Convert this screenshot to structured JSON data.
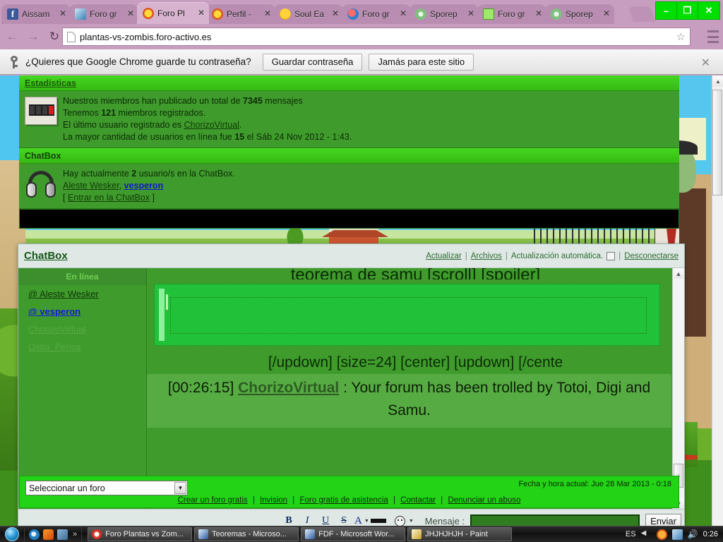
{
  "browser": {
    "tabs": [
      {
        "title": "Aissam",
        "favicon": "facebook-icon",
        "active": false
      },
      {
        "title": "Foro gr",
        "favicon": "forum-blue-icon",
        "active": false
      },
      {
        "title": "Foro Pl",
        "favicon": "sunflower-icon",
        "active": true
      },
      {
        "title": "Perfil -",
        "favicon": "sunflower-icon",
        "active": false
      },
      {
        "title": "Soul Ea",
        "favicon": "soul-icon",
        "active": false
      },
      {
        "title": "Foro gr",
        "favicon": "forum-red-icon",
        "active": false
      },
      {
        "title": "Sporep",
        "favicon": "spore-icon",
        "active": false
      },
      {
        "title": "Foro gr",
        "favicon": "chat-green-icon",
        "active": false
      },
      {
        "title": "Sporep",
        "favicon": "spore-icon",
        "active": false
      }
    ],
    "url": "plantas-vs-zombis.foro-activo.es",
    "window_controls": {
      "minimize": "–",
      "restore": "❐",
      "close": "✕"
    },
    "accent_color": "#c89ec0"
  },
  "infobar": {
    "icon": "key-icon",
    "question": "¿Quieres que Google Chrome guarde tu contraseña?",
    "save_label": "Guardar contraseña",
    "never_label": "Jamás para este sitio",
    "close_label": "✕"
  },
  "statistics": {
    "title": "Estadísticas",
    "icon": "counter-icon",
    "line1_pre": "Nuestros miembros han publicado un total de ",
    "line1_count": "7345",
    "line1_post": " mensajes",
    "line2_pre": "Tenemos ",
    "line2_count": "121",
    "line2_post": " miembros registrados.",
    "line3_pre": "El último usuario registrado es ",
    "line3_user": "ChorizoVirtual",
    "line3_post": ".",
    "line4_pre": "La mayor cantidad de usuarios en línea fue ",
    "line4_count": "15",
    "line4_post": " el Sáb 24 Nov 2012 - 1:43."
  },
  "chatbox_block": {
    "title": "ChatBox",
    "icon": "headphones-icon",
    "line1_pre": "Hay actualmente ",
    "line1_count": "2",
    "line1_post": " usuario/s en la ChatBox.",
    "user1": "Aleste Wesker",
    "user_sep": ", ",
    "user2": "vesperon",
    "enter_bracket_open": "[ ",
    "enter_link": "Entrar en la ChatBox",
    "enter_bracket_close": " ]"
  },
  "chatbox_window": {
    "title": "ChatBox",
    "header_links": {
      "refresh": "Actualizar",
      "archives": "Archivos",
      "auto_refresh": "Actualización automática.",
      "disconnect": "Desconectarse",
      "separator": "|"
    },
    "userlist": {
      "heading": "En línea",
      "users": [
        {
          "name": "@ Aleste Wesker",
          "state": "online"
        },
        {
          "name": "@ vesperon",
          "state": "online-highlight"
        },
        {
          "name": "ChorizoVirtual",
          "state": "offline"
        },
        {
          "name": "Ostia_Perica",
          "state": "offline"
        }
      ]
    },
    "messages": {
      "clipped_top": "teorema de samu [scroll] [spoiler]",
      "bbcode_line": "[/updown] [size=24] [center] [updown] [/cente",
      "last_message": {
        "time": "[00:26:15]",
        "author": "ChorizoVirtual",
        "colon": " : ",
        "text": "Your forum has been trolled by Totoi, Digi and Samu."
      }
    },
    "composer": {
      "bold": "B",
      "italic": "I",
      "underline": "U",
      "strike": "S",
      "color_letter": "A",
      "smiley": "smiley-icon",
      "message_label": "Mensaje :",
      "message_value": "",
      "send_label": "Enviar"
    }
  },
  "footer": {
    "forum_select_value": "Seleccionar un foro",
    "date_text": "Fecha y hora actual: Jue 28 Mar 2013 - 0:18",
    "links": [
      "Crear un foro gratis",
      "Invision",
      "Foro gratis de asistencia",
      "Contactar",
      "Denunciar un abuso"
    ],
    "link_separator": "|"
  },
  "taskbar": {
    "start_label": "start-orb",
    "quicklaunch": [
      "internet-explorer-icon",
      "media-player-icon",
      "show-desktop-icon"
    ],
    "chevron": "»",
    "tasks": [
      {
        "label": "Foro Plantas vs Zom...",
        "icon": "chrome-icon"
      },
      {
        "label": "Teoremas - Microso...",
        "icon": "word-icon"
      },
      {
        "label": "FDF - Microsoft Wor...",
        "icon": "word-icon"
      },
      {
        "label": "JHJHJHJH - Paint",
        "icon": "paint-icon"
      }
    ],
    "tray": {
      "language": "ES",
      "clock": "0:26"
    }
  }
}
